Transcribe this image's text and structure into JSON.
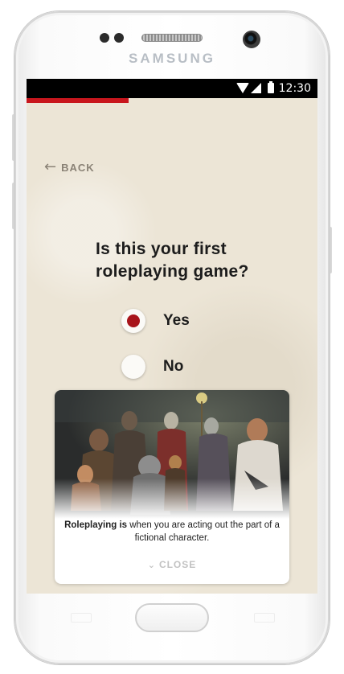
{
  "device": {
    "brand": "SAMSUNG"
  },
  "status_bar": {
    "time": "12:30",
    "icons": [
      "wifi-icon",
      "signal-icon",
      "battery-icon"
    ]
  },
  "progress": {
    "fraction": 0.35,
    "color": "#c8161d"
  },
  "nav": {
    "back_label": "BACK",
    "back_icon": "arrow-left-icon"
  },
  "question": {
    "text": "Is this your first roleplaying game?"
  },
  "options": [
    {
      "label": "Yes",
      "selected": true
    },
    {
      "label": "No",
      "selected": false
    }
  ],
  "info_card": {
    "image": "fantasy-heroes-illustration",
    "term": "Roleplaying is",
    "definition": " when you are acting out the part of a fictional character.",
    "close_label": "CLOSE",
    "close_icon": "chevron-down-icon"
  },
  "colors": {
    "accent": "#a8141b",
    "background": "#ece5d6",
    "text": "#1c1c1c",
    "muted": "#8a8276"
  }
}
